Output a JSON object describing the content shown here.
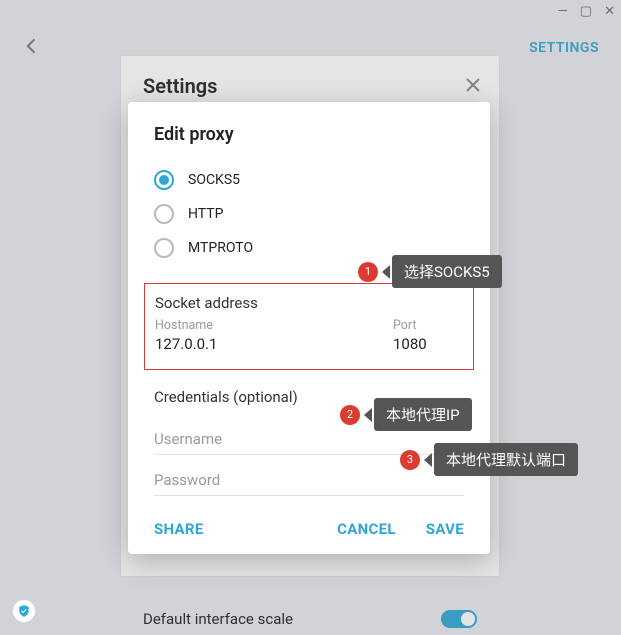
{
  "window": {
    "min": "—",
    "max": "▢",
    "close": "✕"
  },
  "topbar": {
    "settings_link": "SETTINGS"
  },
  "settings_panel": {
    "title": "Settings",
    "interface_scale": "Default interface scale"
  },
  "modal": {
    "title": "Edit proxy",
    "radios": {
      "socks5": "SOCKS5",
      "http": "HTTP",
      "mtproto": "MTPROTO"
    },
    "socket": {
      "section": "Socket address",
      "hostname_label": "Hostname",
      "hostname_value": "127.0.0.1",
      "port_label": "Port",
      "port_value": "1080"
    },
    "credentials": {
      "section": "Credentials (optional)",
      "username_placeholder": "Username",
      "password_placeholder": "Password"
    },
    "actions": {
      "share": "SHARE",
      "cancel": "CANCEL",
      "save": "SAVE"
    }
  },
  "callouts": {
    "c1": {
      "num": "1",
      "text": "选择SOCKS5"
    },
    "c2": {
      "num": "2",
      "text": "本地代理IP"
    },
    "c3": {
      "num": "3",
      "text": "本地代理默认端口"
    }
  }
}
